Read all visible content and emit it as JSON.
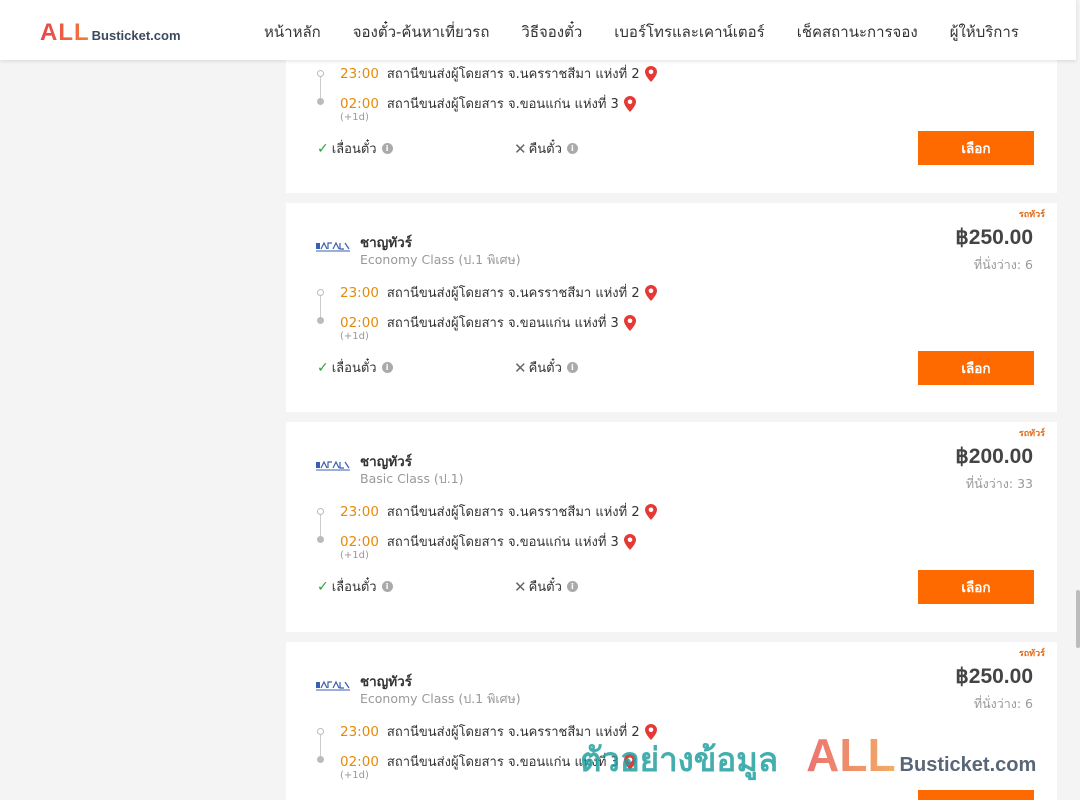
{
  "header": {
    "logo_big": "ALL",
    "logo_small": "Busticket.com",
    "nav": [
      "หน้าหลัก",
      "จองตั๋ว-ค้นหาเที่ยวรถ",
      "วิธีจองตั๋ว",
      "เบอร์โทรและเคาน์เตอร์",
      "เช็คสถานะการจอง",
      "ผู้ให้บริการ"
    ]
  },
  "colors": {
    "accent": "#ff6a00",
    "time": "#e58a0c",
    "check": "#2e9e3e",
    "pin": "#e53935"
  },
  "cards": [
    {
      "badge": "",
      "operator": "",
      "class": "",
      "price": "",
      "seats": "",
      "depart_time": "23:00",
      "depart_station": "สถานีขนส่งผู้โดยสาร จ.นครราชสีมา แห่งที่ 2",
      "arrive_time": "02:00",
      "arrive_station": "สถานีขนส่งผู้โดยสาร จ.ขอนแก่น แห่งที่ 3",
      "next_day": "(+1d)",
      "change": "เลื่อนตั๋ว",
      "refund": "คืนตั๋ว",
      "select": "เลือก"
    },
    {
      "badge": "รถทัวร์",
      "operator": "ชาญทัวร์",
      "class": "Economy Class (ป.1 พิเศษ)",
      "price": "฿250.00",
      "seats": "ที่นั่งว่าง: 6",
      "depart_time": "23:00",
      "depart_station": "สถานีขนส่งผู้โดยสาร จ.นครราชสีมา แห่งที่ 2",
      "arrive_time": "02:00",
      "arrive_station": "สถานีขนส่งผู้โดยสาร จ.ขอนแก่น แห่งที่ 3",
      "next_day": "(+1d)",
      "change": "เลื่อนตั๋ว",
      "refund": "คืนตั๋ว",
      "select": "เลือก"
    },
    {
      "badge": "รถทัวร์",
      "operator": "ชาญทัวร์",
      "class": "Basic Class (ป.1)",
      "price": "฿200.00",
      "seats": "ที่นั่งว่าง: 33",
      "depart_time": "23:00",
      "depart_station": "สถานีขนส่งผู้โดยสาร จ.นครราชสีมา แห่งที่ 2",
      "arrive_time": "02:00",
      "arrive_station": "สถานีขนส่งผู้โดยสาร จ.ขอนแก่น แห่งที่ 3",
      "next_day": "(+1d)",
      "change": "เลื่อนตั๋ว",
      "refund": "คืนตั๋ว",
      "select": "เลือก"
    },
    {
      "badge": "รถทัวร์",
      "operator": "ชาญทัวร์",
      "class": "Economy Class (ป.1 พิเศษ)",
      "price": "฿250.00",
      "seats": "ที่นั่งว่าง: 6",
      "depart_time": "23:00",
      "depart_station": "สถานีขนส่งผู้โดยสาร จ.นครราชสีมา แห่งที่ 2",
      "arrive_time": "02:00",
      "arrive_station": "สถานีขนส่งผู้โดยสาร จ.ขอนแก่น แห่งที่ 3",
      "next_day": "(+1d)",
      "change": "",
      "refund": "",
      "select": ""
    }
  ],
  "watermark": {
    "thai": "ตัวอย่างข้อมูล",
    "all": "ALL",
    "busticket": "Busticket.com"
  }
}
